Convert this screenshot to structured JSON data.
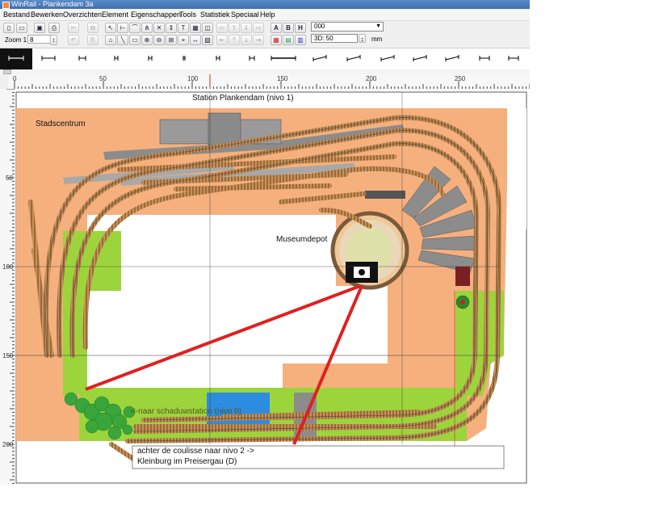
{
  "window": {
    "title": "WinRail - Plankendam 3a"
  },
  "menu": [
    "Bestand",
    "Bewerken",
    "Overzichten",
    "Element",
    "Eigenschappen",
    "Tools",
    "Statistiek",
    "Speciaal",
    "Help"
  ],
  "toolbar": {
    "zoom_label": "Zoom 1:",
    "zoom_value": "8",
    "layer_value": "000",
    "d3_value": "3D: 50",
    "d3_unit": "mm",
    "text_buttons": [
      "A",
      "B",
      "H"
    ]
  },
  "ruler": {
    "h_labels": [
      "0",
      "50",
      "100",
      "150",
      "200",
      "250"
    ],
    "v_labels": [
      "50",
      "100",
      "150",
      "200"
    ]
  },
  "layout": {
    "title": "Station Plankendam (nivo 1)",
    "label_stadscentrum": "Stadscentrum",
    "label_museumdepot": "Museumdepot",
    "label_schaduw": "<-naar schaduwstation (nivo 0)",
    "label_coulisse_1": "achter de coulisse  naar nivo 2 ->",
    "label_coulisse_2": "Kleinburg im Preisergau (D)"
  },
  "colors": {
    "baseboard": "#f5b07e",
    "grass": "#9cd43c",
    "water": "#2c8ce0",
    "track_sleeper": "#b8864a",
    "rail": "#444444",
    "annotation": "#e02020",
    "platform": "#8c8c8c"
  }
}
